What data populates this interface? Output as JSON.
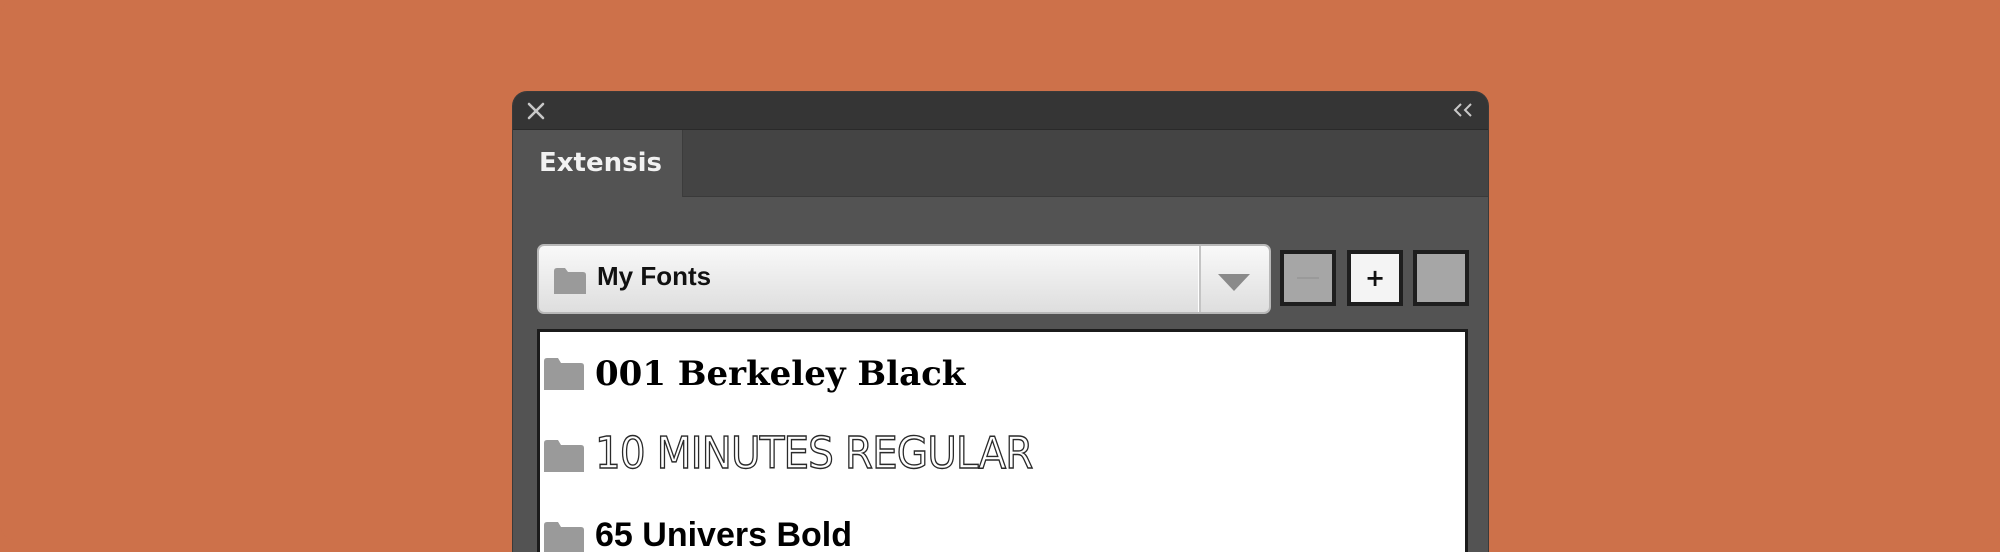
{
  "window": {
    "close_icon": "close-icon",
    "collapse_icon": "double-chevron-left-icon"
  },
  "tabs": [
    {
      "label": "Extensis",
      "active": true
    }
  ],
  "set_selector": {
    "icon": "folder-icon",
    "selected": "My Fonts",
    "arrow_icon": "caret-down-icon"
  },
  "toolbar": {
    "remove_label": "",
    "add_label": "+",
    "more_label": ""
  },
  "font_list": {
    "items": [
      {
        "label": "001 Berkeley Black",
        "icon": "folder-icon"
      },
      {
        "label": "10 MINUTES REGULAR",
        "icon": "folder-icon"
      },
      {
        "label": "65 Univers Bold",
        "icon": "folder-icon"
      }
    ]
  },
  "colors": {
    "background": "#cd714a",
    "panel": "#535353",
    "titlebar": "#353535",
    "list_background": "#ffffff",
    "folder": "#9a9a9a"
  }
}
